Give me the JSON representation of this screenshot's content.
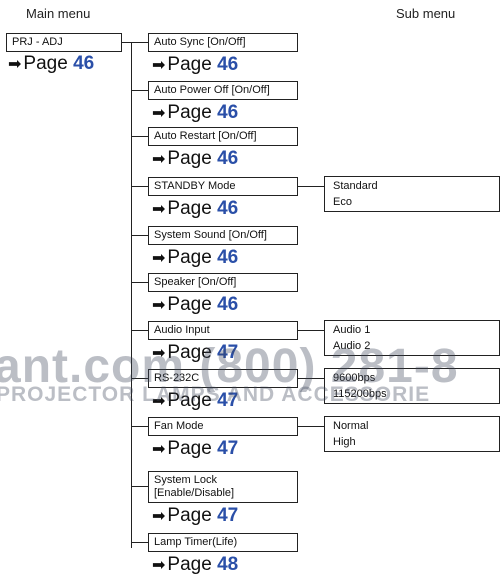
{
  "headers": {
    "main": "Main menu",
    "sub": "Sub menu"
  },
  "main_item": {
    "label": "PRJ - ADJ",
    "page_prefix": "Page",
    "page": "46"
  },
  "items": [
    {
      "label": "Auto Sync [On/Off]",
      "page": "46"
    },
    {
      "label": "Auto Power Off [On/Off]",
      "page": "46"
    },
    {
      "label": "Auto Restart [On/Off]",
      "page": "46"
    },
    {
      "label": "STANDBY Mode",
      "page": "46",
      "sub": [
        "Standard",
        "Eco"
      ]
    },
    {
      "label": "System Sound [On/Off]",
      "page": "46"
    },
    {
      "label": "Speaker [On/Off]",
      "page": "46"
    },
    {
      "label": "Audio Input",
      "page": "47",
      "sub": [
        "Audio 1",
        "Audio 2"
      ]
    },
    {
      "label": "RS-232C",
      "page": "47",
      "sub": [
        "9600bps",
        "115200bps"
      ]
    },
    {
      "label": "Fan Mode",
      "page": "47",
      "sub": [
        "Normal",
        "High"
      ]
    },
    {
      "label": "System Lock\n[Enable/Disable]",
      "page": "47"
    },
    {
      "label": "Lamp Timer(Life)",
      "page": "48"
    }
  ],
  "page_prefix": "Page",
  "arrow": "➡",
  "watermark": {
    "line1": "ant.com (800) 281-8",
    "line2": "PROJECTOR LAMPS AND ACCESSORIE"
  }
}
